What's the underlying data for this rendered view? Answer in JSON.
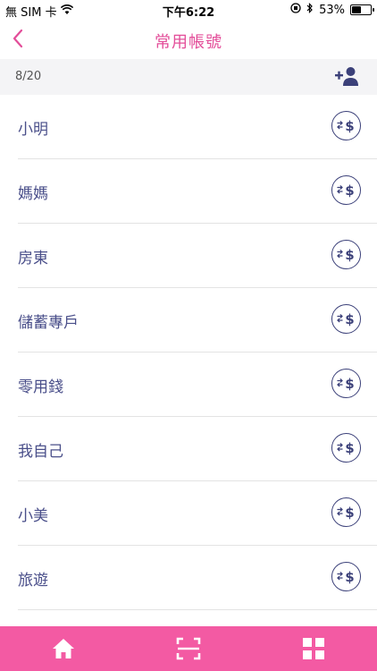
{
  "status_bar": {
    "carrier": "無 SIM 卡",
    "time": "下午6:22",
    "battery_percent_text": "53%",
    "battery_level": 0.53
  },
  "nav": {
    "title": "常用帳號"
  },
  "count": {
    "text": "8/20"
  },
  "accounts": [
    {
      "name": "小明"
    },
    {
      "name": "媽媽"
    },
    {
      "name": "房東"
    },
    {
      "name": "儲蓄專戶"
    },
    {
      "name": "零用錢"
    },
    {
      "name": "我自己"
    },
    {
      "name": "小美"
    },
    {
      "name": "旅遊"
    }
  ],
  "tabs": [
    {
      "icon": "home-icon"
    },
    {
      "icon": "scan-icon"
    },
    {
      "icon": "grid-menu-icon"
    }
  ],
  "colors": {
    "accent": "#e34d99",
    "tab_bar": "#f35aa3",
    "item_text": "#4a4f8a",
    "icon_navy": "#3b4079"
  }
}
